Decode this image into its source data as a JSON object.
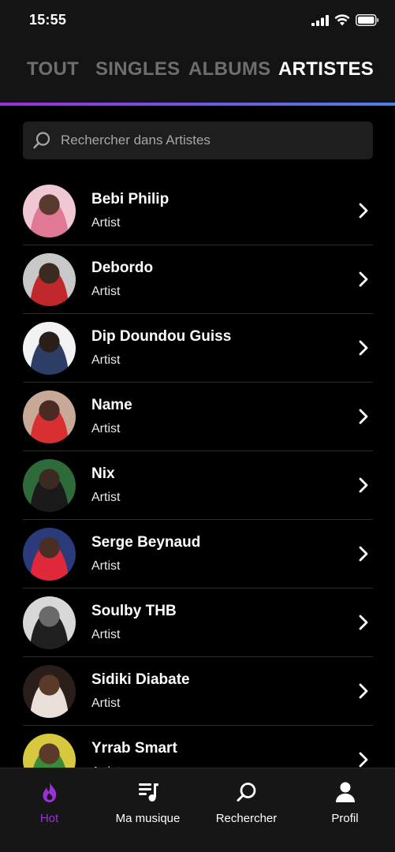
{
  "status": {
    "time": "15:55"
  },
  "tabs": [
    {
      "label": "TOUT",
      "active": false
    },
    {
      "label": "SINGLES",
      "active": false
    },
    {
      "label": "ALBUMS",
      "active": false
    },
    {
      "label": "ARTISTES",
      "active": true
    }
  ],
  "search": {
    "placeholder": "Rechercher dans Artistes",
    "value": ""
  },
  "artists": [
    {
      "name": "Bebi Philip",
      "type": "Artist",
      "avatar_colors": [
        "#f0c8d4",
        "#e07896",
        "#5a3a2e"
      ]
    },
    {
      "name": "Debordo",
      "type": "Artist",
      "avatar_colors": [
        "#c8c8c8",
        "#c0282c",
        "#3a2a20"
      ]
    },
    {
      "name": "Dip Doundou Guiss",
      "type": "Artist",
      "avatar_colors": [
        "#f2f2f4",
        "#2c3e66",
        "#2a1e18"
      ]
    },
    {
      "name": "Name",
      "type": "Artist",
      "avatar_colors": [
        "#c8a896",
        "#d83030",
        "#4a2a22"
      ]
    },
    {
      "name": "Nix",
      "type": "Artist",
      "avatar_colors": [
        "#2e6a3a",
        "#1a1a1a",
        "#3a2a22"
      ]
    },
    {
      "name": "Serge Beynaud",
      "type": "Artist",
      "avatar_colors": [
        "#2a3a7a",
        "#e0283a",
        "#4a2e22"
      ]
    },
    {
      "name": "Soulby THB",
      "type": "Artist",
      "avatar_colors": [
        "#d8d8d8",
        "#202020",
        "#6a6a6a"
      ]
    },
    {
      "name": "Sidiki Diabate",
      "type": "Artist",
      "avatar_colors": [
        "#2a1e1a",
        "#e8e0d8",
        "#5a3a28"
      ]
    },
    {
      "name": "Yrrab Smart",
      "type": "Artist",
      "avatar_colors": [
        "#d8c840",
        "#3a8a3a",
        "#5a3a28"
      ]
    }
  ],
  "bottom_nav": [
    {
      "label": "Hot",
      "icon": "flame-icon",
      "active": true
    },
    {
      "label": "Ma musique",
      "icon": "playlist-icon",
      "active": false
    },
    {
      "label": "Rechercher",
      "icon": "search-icon",
      "active": false
    },
    {
      "label": "Profil",
      "icon": "user-icon",
      "active": false
    }
  ],
  "colors": {
    "accent": "#9b2fd9",
    "accent_gradient_end": "#4f7fe6",
    "background": "#000000",
    "bar_background": "#141414",
    "tab_inactive": "#6e6e6e"
  }
}
